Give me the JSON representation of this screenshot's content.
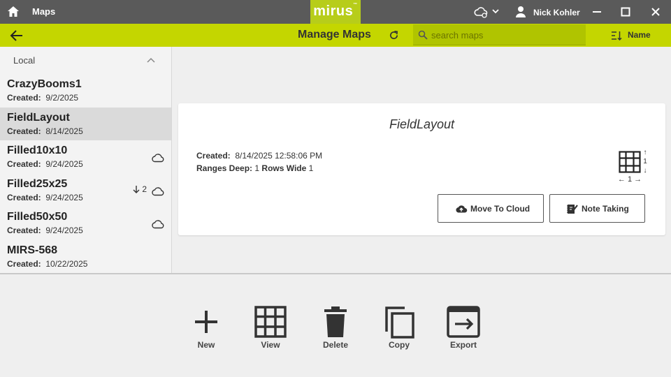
{
  "window": {
    "app_title": "Maps",
    "logo_text": "mirus",
    "logo_mark": "™",
    "user_name": "Nick Kohler"
  },
  "header": {
    "title": "Manage Maps",
    "search_placeholder": "search maps",
    "sort_label": "Name"
  },
  "sidebar": {
    "group_label": "Local",
    "created_label": "Created:",
    "items": [
      {
        "name": "CrazyBooms1",
        "created": "9/2/2025"
      },
      {
        "name": "FieldLayout",
        "created": "8/14/2025"
      },
      {
        "name": "Filled10x10",
        "created": "9/24/2025"
      },
      {
        "name": "Filled25x25",
        "created": "9/24/2025",
        "download_count": "2"
      },
      {
        "name": "Filled50x50",
        "created": "9/24/2025"
      },
      {
        "name": "MIRS-568",
        "created": "10/22/2025"
      }
    ]
  },
  "detail": {
    "title": "FieldLayout",
    "created_label": "Created:",
    "created_value": "8/14/2025 12:58:06 PM",
    "ranges_label": "Ranges Deep:",
    "ranges_value": "1",
    "rows_label": "Rows Wide",
    "rows_value": "1",
    "grid_rows": "1",
    "grid_wide": "1",
    "move_to_cloud": "Move To Cloud",
    "note_taking": "Note Taking"
  },
  "toolbar": {
    "new": "New",
    "view": "View",
    "delete": "Delete",
    "copy": "Copy",
    "export": "Export"
  },
  "colors": {
    "titlebar": "#5a5a5a",
    "brand_green": "#c4d600",
    "logo_green": "#b7cd1a"
  }
}
